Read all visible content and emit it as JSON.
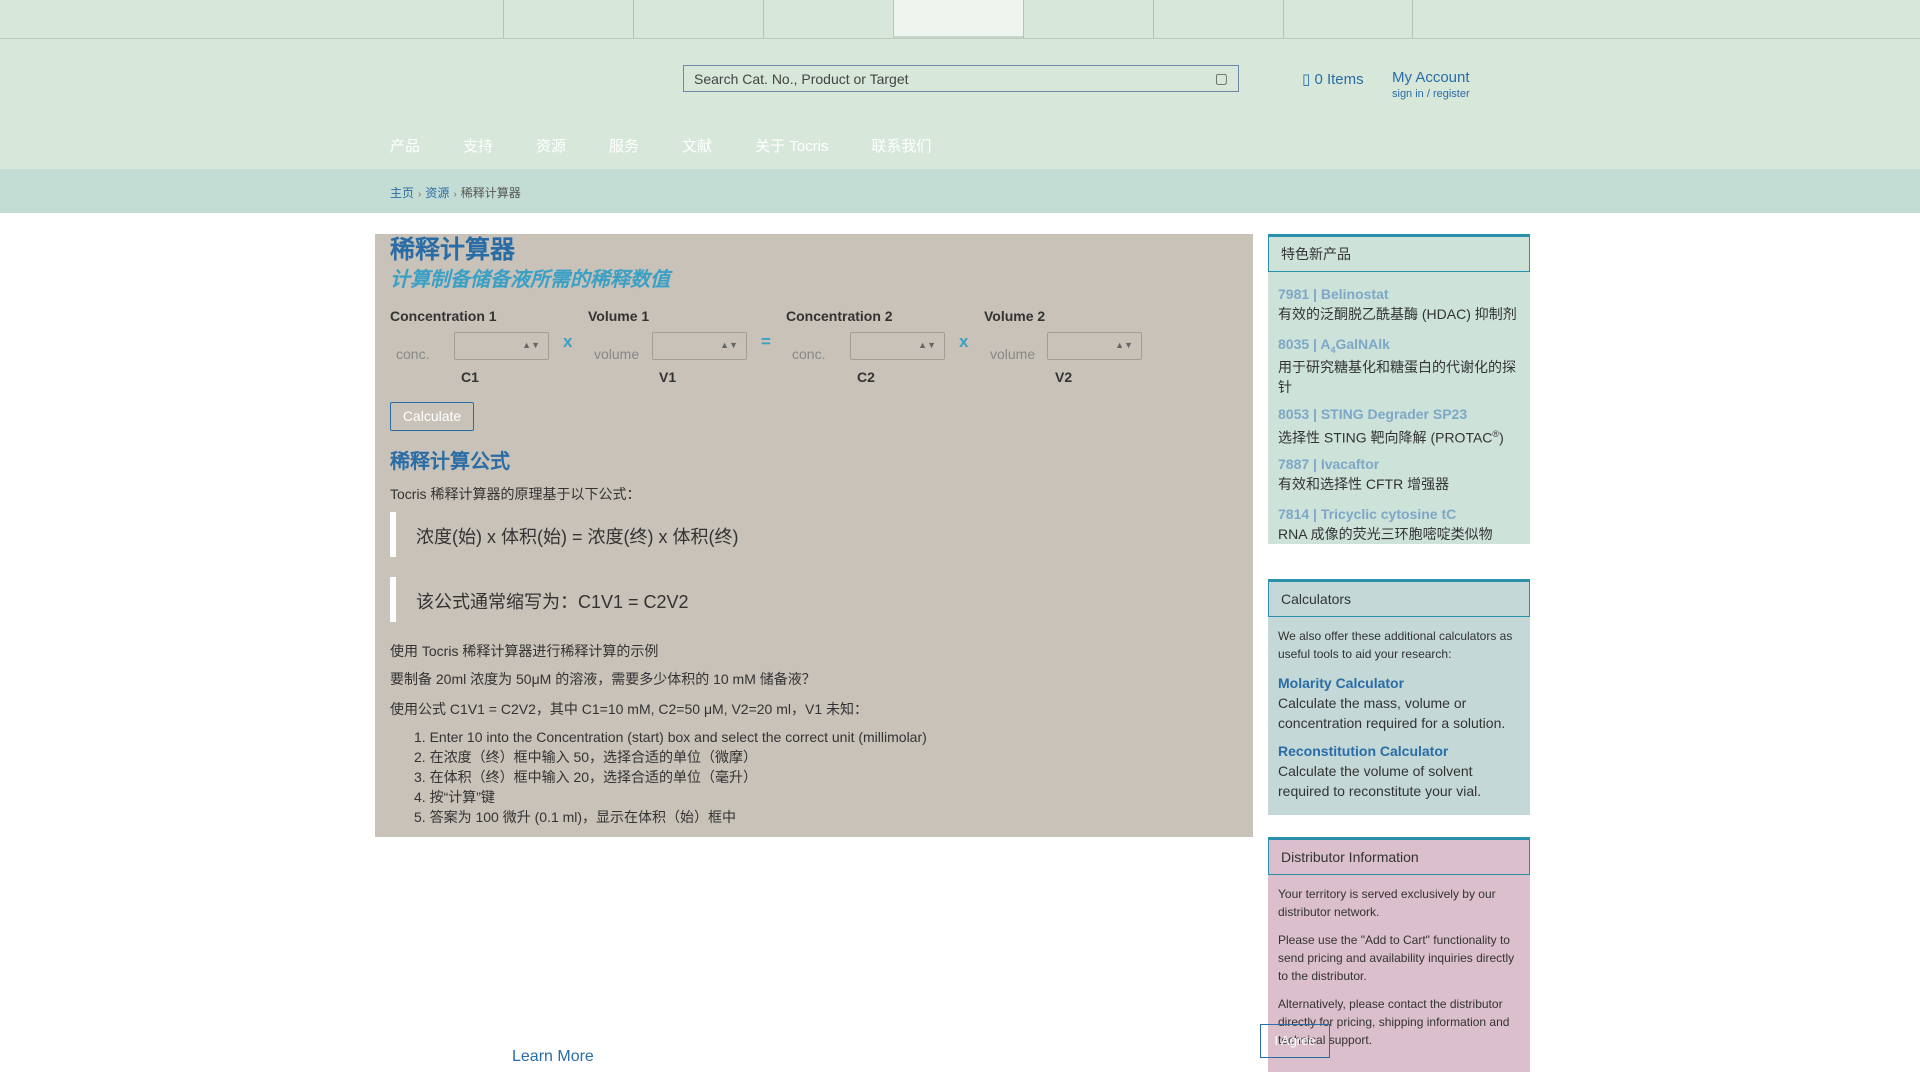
{
  "search": {
    "placeholder": "Search Cat. No., Product or Target"
  },
  "header": {
    "cart_label": "0 Items",
    "account_label": "My Account",
    "account_sub": "sign in / register"
  },
  "nav": [
    "产品",
    "支持",
    "资源",
    "服务",
    "文献",
    "关于 Tocris",
    "联系我们"
  ],
  "breadcrumb": {
    "home": "主页",
    "resources": "资源",
    "current": "稀释计算器"
  },
  "page": {
    "title": "稀释计算器",
    "subtitle": "计算制备储备液所需的稀释数值"
  },
  "calculator": {
    "groups": [
      {
        "label": "Concentration 1",
        "placeholder": "conc.",
        "var": "C1"
      },
      {
        "label": "Volume 1",
        "placeholder": "volume",
        "var": "V1"
      },
      {
        "label": "Concentration 2",
        "placeholder": "conc.",
        "var": "C2"
      },
      {
        "label": "Volume 2",
        "placeholder": "volume",
        "var": "V2"
      }
    ],
    "op_times": "x",
    "op_equals": "=",
    "calculate_label": "Calculate"
  },
  "formula": {
    "heading": "稀释计算公式",
    "intro": "Tocris 稀释计算器的原理基于以下公式：",
    "quote1": "浓度(始) x 体积(始) = 浓度(终) x 体积(终)",
    "quote2": "该公式通常缩写为：C1V1 = C2V2",
    "example_title": "使用 Tocris 稀释计算器进行稀释计算的示例",
    "example_question": "要制备 20ml 浓度为 50μM 的溶液，需要多少体积的 10 mM 储备液？",
    "example_setup": "使用公式 C1V1 = C2V2，其中 C1=10 mM, C2=50 μM, V2=20 ml，V1 未知：",
    "steps": [
      "Enter 10 into the Concentration (start) box and select the correct unit (millimolar)",
      "在浓度（终）框中输入 50，选择合适的单位（微摩）",
      "在体积（终）框中输入 20，选择合适的单位（毫升）",
      "按“计算”键",
      "答案为 100 微升 (0.1 ml)，显示在体积（始）框中"
    ]
  },
  "featured": {
    "heading": "特色新产品",
    "items": [
      {
        "title": "7981 | Belinostat",
        "desc": "有效的泛酮脱乙酰基酶 (HDAC) 抑制剂"
      },
      {
        "title_pre": "8035 | A",
        "title_sub": "4",
        "title_post": "GalNAlk",
        "desc": "用于研究糖基化和糖蛋白的代谢化的探针"
      },
      {
        "title": "8053 | STING Degrader SP23",
        "desc_pre": "选择性 STING 靶向降解 (PROTAC",
        "desc_sup": "®",
        "desc_post": ")"
      },
      {
        "title": "7887 | Ivacaftor",
        "desc": "有效和选择性 CFTR 增强器"
      },
      {
        "title": "7814 | Tricyclic cytosine tC",
        "desc": "RNA 成像的荧光三环胞嘧啶类似物"
      }
    ]
  },
  "calculators": {
    "heading": "Calculators",
    "intro": "We also offer these additional calculators as useful tools to aid your research:",
    "items": [
      {
        "title": "Molarity Calculator",
        "desc": "Calculate the mass, volume or concentration required for a solution."
      },
      {
        "title": "Reconstitution Calculator",
        "desc": "Calculate the volume of solvent required to reconstitute your vial."
      }
    ]
  },
  "distributor": {
    "heading": "Distributor Information",
    "p1": "Your territory is served exclusively by our distributor network.",
    "p2": "Please use the \"Add to Cart\" functionality to send pricing and availability inquiries directly to the distributor.",
    "p3": "Alternatively, please contact the distributor directly for pricing, shipping information and technical support."
  },
  "cookie": {
    "agree_label": "I Agree",
    "learn_more": "Learn More"
  }
}
